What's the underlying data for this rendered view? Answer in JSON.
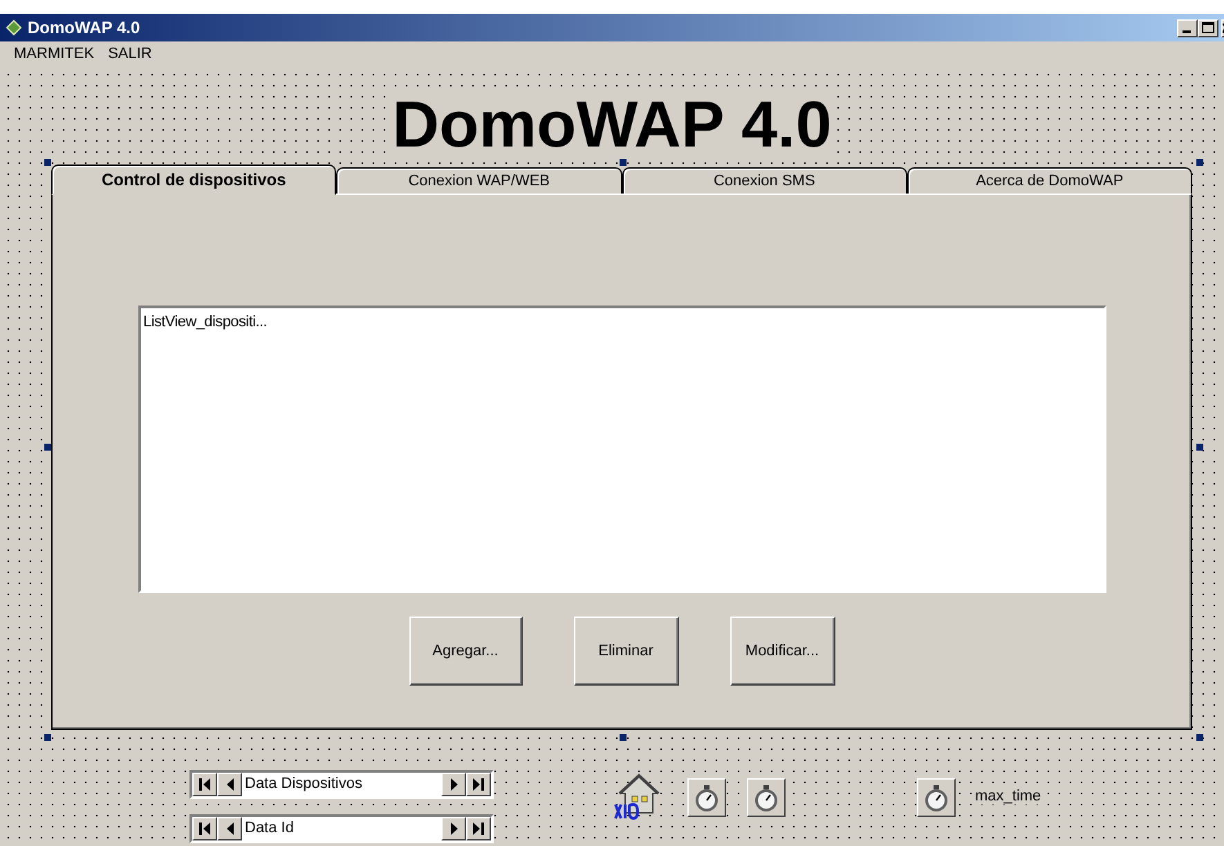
{
  "window": {
    "title": "DomoWAP 4.0"
  },
  "menu": [
    "MARMITEK",
    "SALIR"
  ],
  "heading": "DomoWAP 4.0",
  "tabs": [
    {
      "label": "Control de dispositivos",
      "selected": true
    },
    {
      "label": "Conexion WAP/WEB",
      "selected": false
    },
    {
      "label": "Conexion SMS",
      "selected": false
    },
    {
      "label": "Acerca de DomoWAP",
      "selected": false
    }
  ],
  "list_view": {
    "caption": "ListView_dispositi..."
  },
  "buttons": [
    "Agregar...",
    "Eliminar",
    "Modificar..."
  ],
  "data_controls": [
    {
      "caption": "Data Dispositivos"
    },
    {
      "caption": "Data Id"
    }
  ],
  "timer_label": "max_time"
}
